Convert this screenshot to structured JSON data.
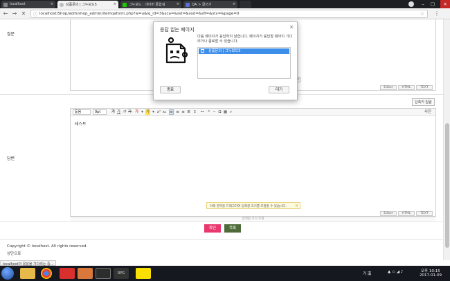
{
  "browser": {
    "tabs": [
      {
        "title": "localhost",
        "favicon_color": "#888888"
      },
      {
        "title": "상품문의 | 그누보드5",
        "favicon_color": "#bdbdbd"
      },
      {
        "title": "그누보드 : 네이버 통합검",
        "favicon_color": "#1ec800"
      },
      {
        "title": "QA > 글쓰기",
        "favicon_color": "#5a6fd1"
      }
    ],
    "url": "localhost/Shop/adm/shop_admin/itemqaform.php?w=u&iq_id=3&sca=&sst=&sod=&sfl=&stx=&page=0"
  },
  "page": {
    "question_label": "질문",
    "answer_label": "답변",
    "shortcut_button": "단축키 일람",
    "editor_toolbar": {
      "font_select": "돋움",
      "size_select": "9pt",
      "photo_label": "사진"
    },
    "editor_body_text": "테스트",
    "mode_buttons": [
      "Editor",
      "HTML",
      "TEXT"
    ],
    "resize_text": "입력창 크기 조절",
    "notice_text": "아래 영역을 드래그하여 입력창 크기를 조절할 수 있습니다.",
    "ok_button": "확인",
    "list_button": "목록",
    "copyright": "Copyright © localhost. All rights reserved.",
    "top_link": "상단으로"
  },
  "dialog": {
    "title": "응답 없는 페이지",
    "message": "다음 페이지가 응답하지 않습니다. 페이지가 응답할 때까지 기다리거나 종료할 수 있습니다.",
    "list_item": "상품문의 | 그누보드5",
    "kill_button": "종료",
    "wait_button": "대기"
  },
  "status_text": "localhost의 응답을 기다리는 중...",
  "taskbar": {
    "ime": "가 漢",
    "clock_time": "오후 10:15",
    "clock_date": "2017-01-09",
    "icons": [
      "explorer",
      "chrome",
      "app-red",
      "app-orange",
      "app-circle",
      "rpg",
      "kakaotalk"
    ]
  },
  "colors": {
    "accent_pink": "#e8386d",
    "accent_green": "#4f6b3a",
    "selection_blue": "#3d8ee8",
    "taskbar": "#15191f"
  }
}
